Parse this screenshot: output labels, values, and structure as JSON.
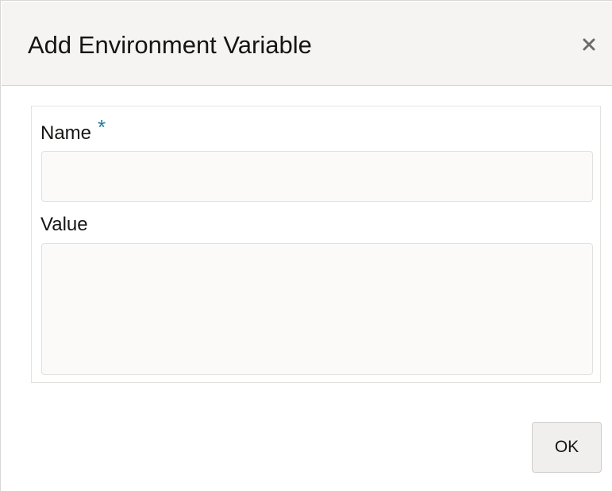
{
  "dialog": {
    "title": "Add Environment Variable",
    "close_icon": "close-icon"
  },
  "form": {
    "name_label": "Name",
    "required_marker": "*",
    "name_value": "",
    "value_label": "Value",
    "value_value": ""
  },
  "footer": {
    "ok_label": "OK"
  },
  "colors": {
    "header_bg": "#f5f4f2",
    "required_accent": "#227e9e",
    "input_bg": "#fbfaf9",
    "button_bg": "#f1efed"
  }
}
